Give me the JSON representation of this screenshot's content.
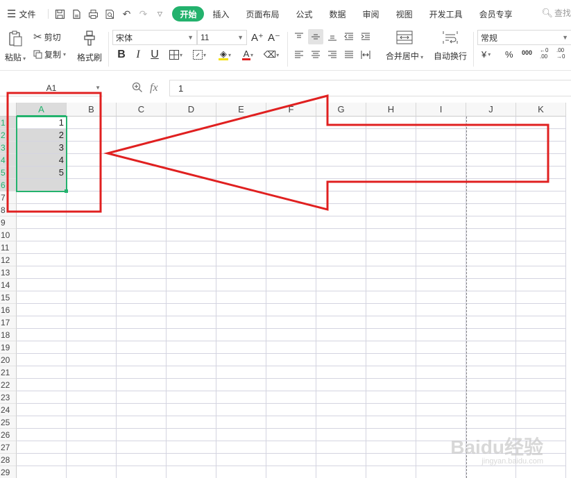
{
  "menu": {
    "file_label": "文件",
    "tabs": [
      "开始",
      "插入",
      "页面布局",
      "公式",
      "数据",
      "审阅",
      "视图",
      "开发工具",
      "会员专享"
    ],
    "active_tab": "开始",
    "search_label": "查找"
  },
  "ribbon": {
    "paste_label": "粘贴",
    "cut_label": "剪切",
    "copy_label": "复制",
    "format_painter_label": "格式刷",
    "font_name": "宋体",
    "font_size": "11",
    "grow_font": "A⁺",
    "shrink_font": "A⁻",
    "bold": "B",
    "italic": "I",
    "underline": "U",
    "font_color_glyph": "A",
    "merge_center_label": "合并居中",
    "wrap_text_label": "自动换行",
    "number_format": "常规",
    "currency_glyph": "¥",
    "percent_glyph": "%",
    "thousands_glyph": "000",
    "inc_decimal_glyph": "←0 .00",
    "dec_decimal_glyph": ".00 →0"
  },
  "formula_bar": {
    "name_box": "A1",
    "fx_label": "fx",
    "value": "1"
  },
  "sheet": {
    "columns": [
      "A",
      "B",
      "C",
      "D",
      "E",
      "F",
      "G",
      "H",
      "I",
      "J",
      "K"
    ],
    "rows": [
      "1",
      "2",
      "3",
      "4",
      "5",
      "6",
      "7",
      "8",
      "9",
      "10",
      "11",
      "12",
      "13",
      "14",
      "15",
      "16",
      "17",
      "18",
      "19",
      "20",
      "21",
      "22",
      "23",
      "24",
      "25",
      "26",
      "27",
      "28",
      "29"
    ],
    "cells": {
      "A1": "1",
      "A2": "2",
      "A3": "3",
      "A4": "4",
      "A5": "5"
    },
    "selected_range": "A1:A6"
  },
  "colors": {
    "accent": "#23b26d",
    "annotation": "#e02020"
  },
  "watermark": {
    "brand": "Baidu经验",
    "url": "jingyan.baidu.com"
  }
}
